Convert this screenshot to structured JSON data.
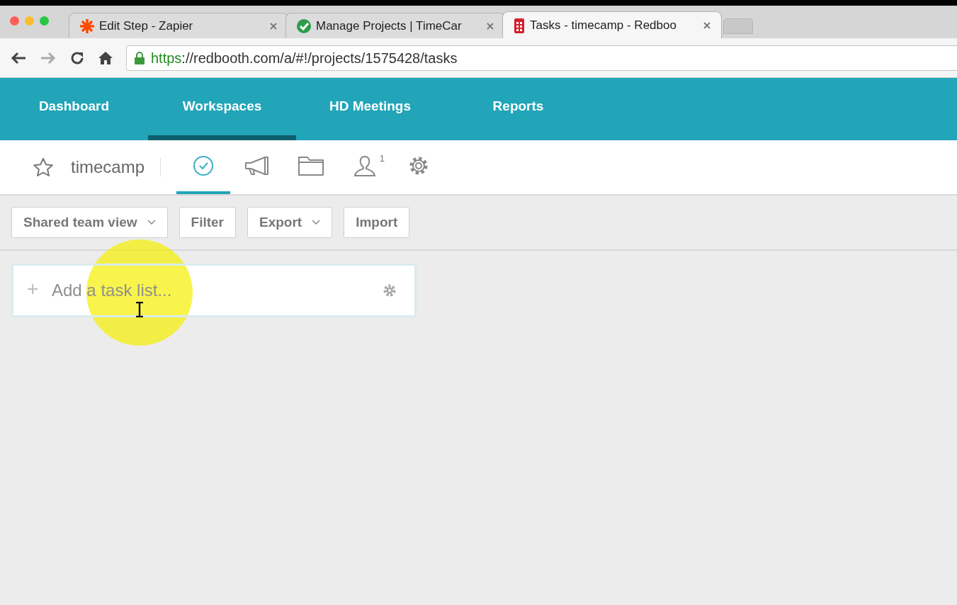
{
  "browser": {
    "tabs": [
      {
        "label": "Edit Step - Zapier",
        "kind": "zapier",
        "selected": false
      },
      {
        "label": "Manage Projects | TimeCar",
        "kind": "timecamp",
        "selected": false
      },
      {
        "label": "Tasks - timecamp - Redboo",
        "kind": "redbooth",
        "selected": true
      }
    ],
    "url": {
      "scheme": "https",
      "rest": "://redbooth.com/a/#!/projects/1575428/tasks"
    }
  },
  "nav": [
    {
      "label": "Dashboard",
      "selected": false
    },
    {
      "label": "Workspaces",
      "selected": true
    },
    {
      "label": "HD Meetings",
      "selected": false
    },
    {
      "label": "Reports",
      "selected": false
    }
  ],
  "workspace": {
    "name": "timecamp",
    "starred": false,
    "tools": [
      {
        "kind": "tasks",
        "selected": true
      },
      {
        "kind": "discussions",
        "selected": false
      },
      {
        "kind": "files",
        "selected": false
      },
      {
        "kind": "people",
        "selected": false,
        "badge": "1"
      },
      {
        "kind": "settings",
        "selected": false
      }
    ]
  },
  "toolbar": [
    {
      "label": "Shared team view",
      "dropdown": true
    },
    {
      "label": "Filter",
      "dropdown": false
    },
    {
      "label": "Export",
      "dropdown": true
    },
    {
      "label": "Import",
      "dropdown": false
    }
  ],
  "add_task_list": {
    "icon": "+",
    "placeholder": "Add a task list..."
  }
}
